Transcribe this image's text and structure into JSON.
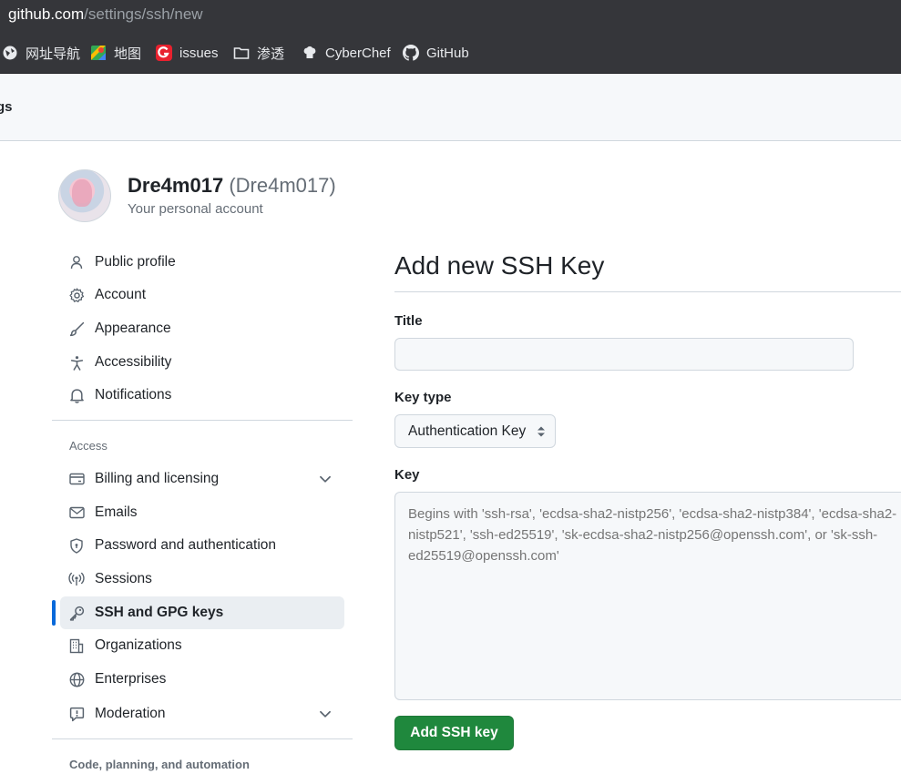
{
  "browser": {
    "url_host": "github.com",
    "url_path": "/settings/ssh/new",
    "bookmarks": [
      {
        "label": "网址导航",
        "icon": "globe-icon"
      },
      {
        "label": "地图",
        "icon": "maps-icon"
      },
      {
        "label": "issues",
        "icon": "issues-logo-icon"
      },
      {
        "label": "渗透",
        "icon": "folder-icon"
      },
      {
        "label": "CyberChef",
        "icon": "chef-hat-icon"
      },
      {
        "label": "GitHub",
        "icon": "github-icon"
      }
    ]
  },
  "header": {
    "crumb": "gs"
  },
  "account": {
    "name": "Dre4m017",
    "login": "(Dre4m017)",
    "subtitle": "Your personal account"
  },
  "sidebar": {
    "items": [
      {
        "label": "Public profile",
        "icon": "person-icon"
      },
      {
        "label": "Account",
        "icon": "gear-icon"
      },
      {
        "label": "Appearance",
        "icon": "paintbrush-icon"
      },
      {
        "label": "Accessibility",
        "icon": "accessibility-icon"
      },
      {
        "label": "Notifications",
        "icon": "bell-icon"
      }
    ],
    "access_label": "Access",
    "access_items": [
      {
        "label": "Billing and licensing",
        "icon": "credit-card-icon",
        "expandable": true
      },
      {
        "label": "Emails",
        "icon": "mail-icon"
      },
      {
        "label": "Password and authentication",
        "icon": "shield-lock-icon"
      },
      {
        "label": "Sessions",
        "icon": "broadcast-icon"
      },
      {
        "label": "SSH and GPG keys",
        "icon": "key-icon",
        "active": true
      },
      {
        "label": "Organizations",
        "icon": "organization-icon"
      },
      {
        "label": "Enterprises",
        "icon": "globe-icon"
      },
      {
        "label": "Moderation",
        "icon": "report-icon",
        "expandable": true
      }
    ],
    "code_label": "Code, planning, and automation"
  },
  "form": {
    "heading": "Add new SSH Key",
    "title_label": "Title",
    "title_value": "",
    "key_type_label": "Key type",
    "key_type_value": "Authentication Key",
    "key_label": "Key",
    "key_placeholder": "Begins with 'ssh-rsa', 'ecdsa-sha2-nistp256', 'ecdsa-sha2-nistp384', 'ecdsa-sha2-nistp521', 'ssh-ed25519', 'sk-ecdsa-sha2-nistp256@openssh.com', or 'sk-ssh-ed25519@openssh.com'",
    "submit_label": "Add SSH key"
  },
  "colors": {
    "primary_button": "#1f883d",
    "active_indicator": "#0969da",
    "chrome_bg": "#35363a"
  }
}
